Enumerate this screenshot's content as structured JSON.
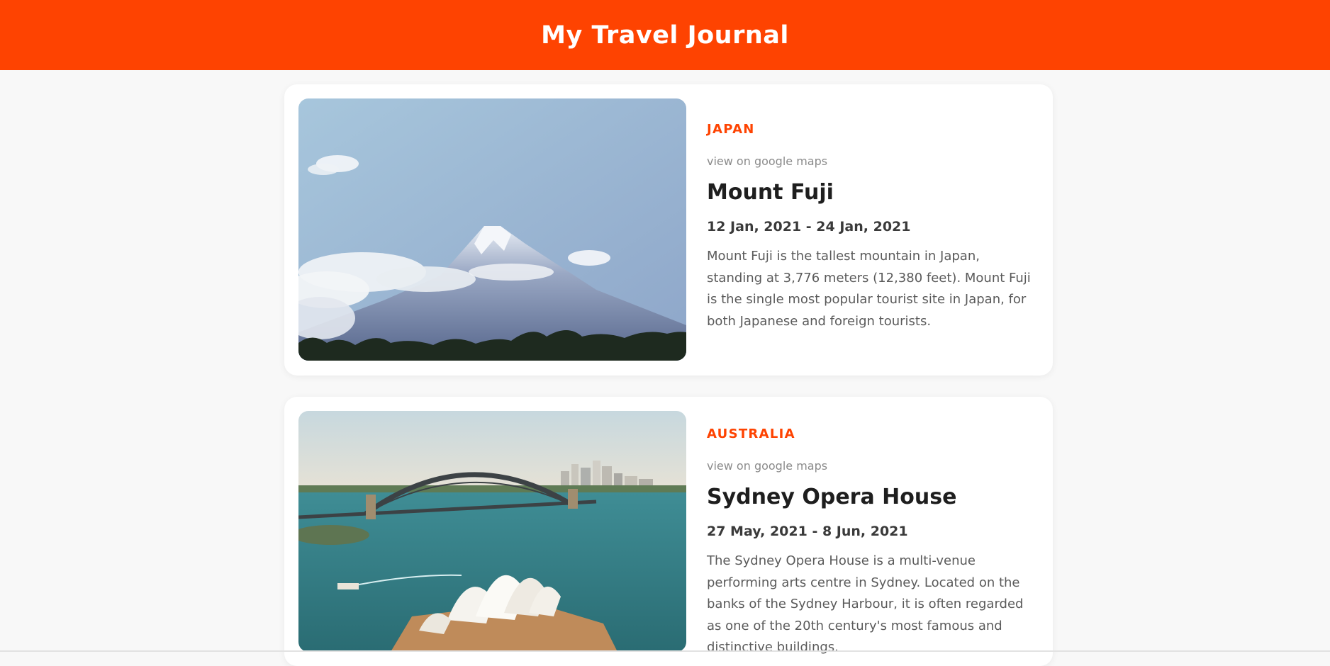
{
  "header": {
    "title": "My Travel Journal"
  },
  "entries": [
    {
      "country": "JAPAN",
      "maps_link": "view on google maps",
      "place": "Mount Fuji",
      "dates": "12 Jan, 2021 - 24 Jan, 2021",
      "description": "Mount Fuji is the tallest mountain in Japan, standing at 3,776 meters (12,380 feet). Mount Fuji is the single most popular tourist site in Japan, for both Japanese and foreign tourists."
    },
    {
      "country": "AUSTRALIA",
      "maps_link": "view on google maps",
      "place": "Sydney Opera House",
      "dates": "27 May, 2021 - 8 Jun, 2021",
      "description": "The Sydney Opera House is a multi-venue performing arts centre in Sydney. Located on the banks of the Sydney Harbour, it is often regarded as one of the 20th century's most famous and distinctive buildings."
    }
  ],
  "colors": {
    "accent": "#fe4301",
    "background": "#f8f8f8",
    "card": "#ffffff"
  }
}
